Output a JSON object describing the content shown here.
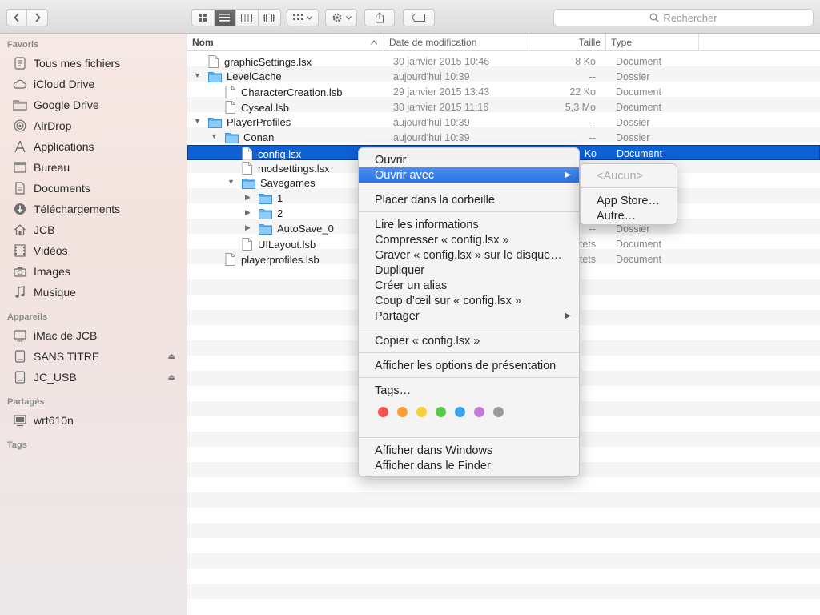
{
  "toolbar": {
    "search_placeholder": "Rechercher"
  },
  "sidebar": {
    "sections": [
      {
        "label": "Favoris"
      },
      {
        "label": "Appareils"
      },
      {
        "label": "Partagés"
      },
      {
        "label": "Tags"
      }
    ],
    "favorites": [
      {
        "label": "Tous mes fichiers",
        "icon": "all-files-icon"
      },
      {
        "label": "iCloud Drive",
        "icon": "cloud-icon"
      },
      {
        "label": "Google Drive",
        "icon": "folder-icon"
      },
      {
        "label": "AirDrop",
        "icon": "airdrop-icon"
      },
      {
        "label": "Applications",
        "icon": "applications-icon"
      },
      {
        "label": "Bureau",
        "icon": "desktop-icon"
      },
      {
        "label": "Documents",
        "icon": "documents-icon"
      },
      {
        "label": "Téléchargements",
        "icon": "downloads-icon"
      },
      {
        "label": "JCB",
        "icon": "home-icon"
      },
      {
        "label": "Vidéos",
        "icon": "movies-icon"
      },
      {
        "label": "Images",
        "icon": "camera-icon"
      },
      {
        "label": "Musique",
        "icon": "music-icon"
      }
    ],
    "devices": [
      {
        "label": "iMac de JCB",
        "icon": "imac-icon"
      },
      {
        "label": "SANS TITRE",
        "icon": "disk-icon"
      },
      {
        "label": "JC_USB",
        "icon": "disk-icon"
      }
    ],
    "shared": [
      {
        "label": "wrt610n",
        "icon": "network-computer-icon"
      }
    ]
  },
  "columns": {
    "name": "Nom",
    "date": "Date de modification",
    "size": "Taille",
    "type": "Type"
  },
  "files": [
    {
      "name": "graphicSettings.lsx",
      "kind": "doc",
      "date": "30 janvier 2015 10:46",
      "size": "8 Ko",
      "type": "Document"
    },
    {
      "name": "LevelCache",
      "kind": "folder",
      "date": "aujourd'hui 10:39",
      "size": "--",
      "type": "Dossier"
    },
    {
      "name": "CharacterCreation.lsb",
      "kind": "doc",
      "date": "29 janvier 2015 13:43",
      "size": "22 Ko",
      "type": "Document"
    },
    {
      "name": "Cyseal.lsb",
      "kind": "doc",
      "date": "30 janvier 2015 11:16",
      "size": "5,3 Mo",
      "type": "Document"
    },
    {
      "name": "PlayerProfiles",
      "kind": "folder",
      "date": "aujourd'hui 10:39",
      "size": "--",
      "type": "Dossier"
    },
    {
      "name": "Conan",
      "kind": "folder",
      "date": "aujourd'hui 10:39",
      "size": "--",
      "type": "Dossier"
    },
    {
      "name": "config.lsx",
      "kind": "doc",
      "date": "",
      "size": "Ko",
      "type": "Document"
    },
    {
      "name": "modsettings.lsx",
      "kind": "doc",
      "date": "",
      "size": "",
      "type": ""
    },
    {
      "name": "Savegames",
      "kind": "folder",
      "date": "",
      "size": "",
      "type": ""
    },
    {
      "name": "1",
      "kind": "folder",
      "date": "",
      "size": "",
      "type": ""
    },
    {
      "name": "2",
      "kind": "folder",
      "date": "",
      "size": "",
      "type": ""
    },
    {
      "name": "AutoSave_0",
      "kind": "folder",
      "date": "",
      "size": "--",
      "type": "Dossier"
    },
    {
      "name": "UILayout.lsb",
      "kind": "doc",
      "date": "",
      "size": "tets",
      "type": "Document"
    },
    {
      "name": "playerprofiles.lsb",
      "kind": "doc",
      "date": "",
      "size": "tets",
      "type": "Document"
    }
  ],
  "context_menu": {
    "items": [
      {
        "label": "Ouvrir"
      },
      {
        "label": "Ouvrir avec"
      },
      {
        "label": "Placer dans la corbeille"
      },
      {
        "label": "Lire les informations"
      },
      {
        "label": "Compresser « config.lsx »"
      },
      {
        "label": "Graver « config.lsx » sur le disque…"
      },
      {
        "label": "Dupliquer"
      },
      {
        "label": "Créer un alias"
      },
      {
        "label": "Coup d’œil sur « config.lsx »"
      },
      {
        "label": "Partager"
      },
      {
        "label": "Copier « config.lsx »"
      },
      {
        "label": "Afficher les options de présentation"
      },
      {
        "label": "Tags…"
      },
      {
        "label": "Afficher dans Windows"
      },
      {
        "label": "Afficher dans le Finder"
      }
    ],
    "tag_colors": [
      {
        "name": "Rouge",
        "color": "#f0524f"
      },
      {
        "name": "Orange",
        "color": "#f5a03b"
      },
      {
        "name": "Jaune",
        "color": "#f5cf3d"
      },
      {
        "name": "Vert",
        "color": "#5bc94c"
      },
      {
        "name": "Bleu",
        "color": "#3aa0f0"
      },
      {
        "name": "Violet",
        "color": "#c67ad7"
      },
      {
        "name": "Gris",
        "color": "#9b9b9b"
      }
    ]
  },
  "submenu": {
    "items": [
      {
        "label": "<Aucun>"
      },
      {
        "label": "App Store…"
      },
      {
        "label": "Autre…"
      }
    ]
  }
}
